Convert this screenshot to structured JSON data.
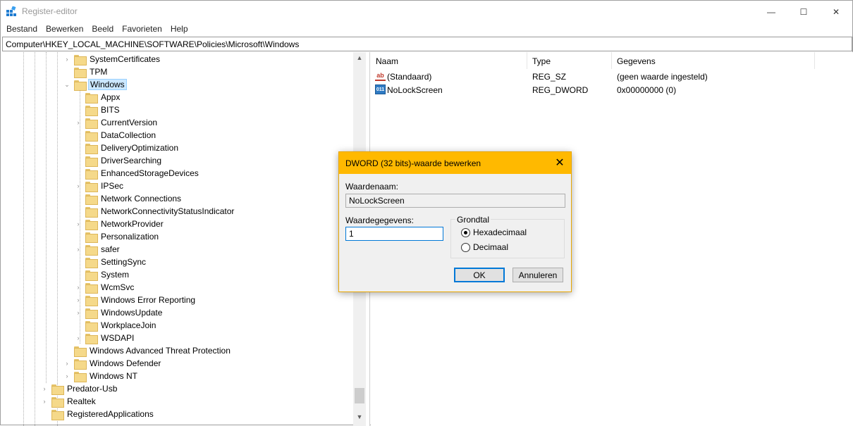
{
  "window": {
    "title": "Register-editor",
    "controls": {
      "minimize": "—",
      "maximize": "☐",
      "close": "✕"
    }
  },
  "menu": [
    "Bestand",
    "Bewerken",
    "Beeld",
    "Favorieten",
    "Help"
  ],
  "address": "Computer\\HKEY_LOCAL_MACHINE\\SOFTWARE\\Policies\\Microsoft\\Windows",
  "tree": [
    {
      "label": "SystemCertificates",
      "expander": "›"
    },
    {
      "label": "TPM",
      "expander": ""
    },
    {
      "label": "Windows",
      "expander": "⌄",
      "selected": true
    },
    {
      "label": "Appx",
      "expander": ""
    },
    {
      "label": "BITS",
      "expander": ""
    },
    {
      "label": "CurrentVersion",
      "expander": "›"
    },
    {
      "label": "DataCollection",
      "expander": ""
    },
    {
      "label": "DeliveryOptimization",
      "expander": ""
    },
    {
      "label": "DriverSearching",
      "expander": ""
    },
    {
      "label": "EnhancedStorageDevices",
      "expander": ""
    },
    {
      "label": "IPSec",
      "expander": "›"
    },
    {
      "label": "Network Connections",
      "expander": ""
    },
    {
      "label": "NetworkConnectivityStatusIndicator",
      "expander": ""
    },
    {
      "label": "NetworkProvider",
      "expander": "›"
    },
    {
      "label": "Personalization",
      "expander": ""
    },
    {
      "label": "safer",
      "expander": "›"
    },
    {
      "label": "SettingSync",
      "expander": ""
    },
    {
      "label": "System",
      "expander": ""
    },
    {
      "label": "WcmSvc",
      "expander": "›"
    },
    {
      "label": "Windows Error Reporting",
      "expander": "›"
    },
    {
      "label": "WindowsUpdate",
      "expander": "›"
    },
    {
      "label": "WorkplaceJoin",
      "expander": ""
    },
    {
      "label": "WSDAPI",
      "expander": "›"
    },
    {
      "label": "Windows Advanced Threat Protection",
      "expander": ""
    },
    {
      "label": "Windows Defender",
      "expander": "›"
    },
    {
      "label": "Windows NT",
      "expander": "›"
    },
    {
      "label": "Predator-Usb",
      "expander": "›"
    },
    {
      "label": "Realtek",
      "expander": "›"
    },
    {
      "label": "RegisteredApplications",
      "expander": ""
    }
  ],
  "list": {
    "headers": {
      "name": "Naam",
      "type": "Type",
      "data": "Gegevens"
    },
    "rows": [
      {
        "icon": "ab",
        "name": "(Standaard)",
        "type": "REG_SZ",
        "data": "(geen waarde ingesteld)"
      },
      {
        "icon": "011",
        "name": "NoLockScreen",
        "type": "REG_DWORD",
        "data": "0x00000000 (0)"
      }
    ]
  },
  "dialog": {
    "title": "DWORD (32 bits)-waarde bewerken",
    "close_glyph": "✕",
    "name_label": "Waardenaam:",
    "name_value": "NoLockScreen",
    "data_label": "Waardegegevens:",
    "data_value": "1",
    "base_label": "Grondtal",
    "base_hex": "Hexadecimaal",
    "base_dec": "Decimaal",
    "ok": "OK",
    "cancel": "Annuleren"
  },
  "colors": {
    "dialog_title": "#ffb900",
    "selection": "#cce8ff",
    "folder": "#f5d98a"
  }
}
